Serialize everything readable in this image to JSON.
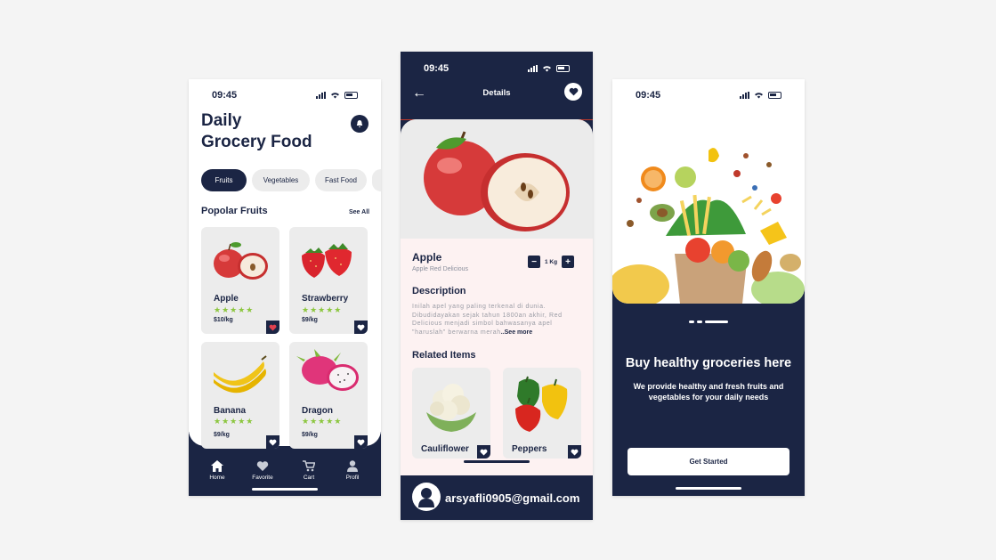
{
  "colors": {
    "navy": "#1b2544",
    "accent_green": "#8cc63f",
    "card_bg": "#ececec",
    "detail_bg": "#fdf2f2"
  },
  "screen_home": {
    "status_time": "09:45",
    "title_line1": "Daily",
    "title_line2": "Grocery Food",
    "notification_icon": "bell-icon",
    "tabs": [
      {
        "label": "Fruits",
        "active": true
      },
      {
        "label": "Vegetables",
        "active": false
      },
      {
        "label": "Fast Food",
        "active": false
      }
    ],
    "section_title": "Popolar Fruits",
    "see_all": "See All",
    "products": [
      {
        "name": "Apple",
        "stars": "★★★★★",
        "price": "$10/kg",
        "rating": 5,
        "favorited": true
      },
      {
        "name": "Strawberry",
        "stars": "★★★★★",
        "price": "$9/kg",
        "rating": 5,
        "favorited": false
      },
      {
        "name": "Banana",
        "stars": "★★★★★",
        "price": "$9/kg",
        "rating": 5,
        "favorited": false
      },
      {
        "name": "Dragon",
        "stars": "★★★★★",
        "price": "$9/kg",
        "rating": 5,
        "favorited": false
      }
    ],
    "nav": [
      {
        "label": "Home",
        "icon": "home-icon"
      },
      {
        "label": "Favorite",
        "icon": "heart-icon"
      },
      {
        "label": "Cart",
        "icon": "cart-icon"
      },
      {
        "label": "Profil",
        "icon": "user-icon"
      }
    ]
  },
  "screen_details": {
    "status_time": "09:45",
    "header_title": "Details",
    "product_name": "Apple",
    "product_subtitle": "Apple  Red Delicious",
    "quantity": "1 Kg",
    "description_title": "Description",
    "description_text": "Inilah apel yang paling terkenal di dunia. Dibudidayakan sejak tahun 1800an akhir, Red Delicious menjadi simbol bahwasanya apel \"haruslah\" berwarna merah",
    "see_more": "..See more",
    "related_title": "Related Items",
    "related": [
      {
        "name": "Cauliflower"
      },
      {
        "name": "Peppers"
      }
    ],
    "email": "arsyafli0905@gmail.com"
  },
  "screen_onboarding": {
    "status_time": "09:45",
    "headline": "Buy healthy groceries here",
    "subtext": "We provide healthy and fresh fruits and vegetables for your daily needs",
    "cta_label": "Get Started",
    "page_indicator": {
      "current": 3,
      "total": 3
    }
  }
}
